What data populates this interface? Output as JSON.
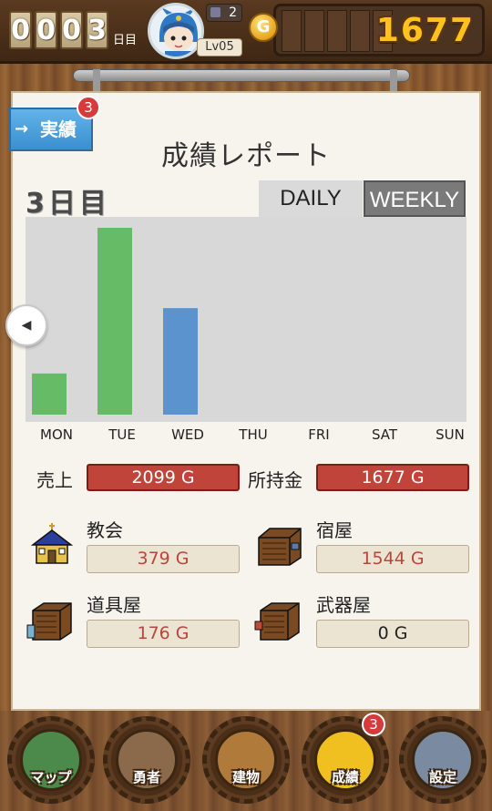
{
  "header": {
    "day_digits": [
      "0",
      "0",
      "0",
      "3"
    ],
    "day_unit": "日目",
    "notification_count": "2",
    "level": "Lv05",
    "coin_symbol": "G",
    "gold": "1677"
  },
  "panel": {
    "achievement_tab": "実績",
    "achievement_badge": "3",
    "title": "成績レポート",
    "day_label": "3日目",
    "tabs": {
      "daily": "DAILY",
      "weekly": "WEEKLY"
    }
  },
  "chart_data": {
    "type": "bar",
    "categories": [
      "MON",
      "TUE",
      "WED",
      "THU",
      "FRI",
      "SAT",
      "SUN"
    ],
    "values": [
      0.22,
      1.0,
      0.57,
      0,
      0,
      0,
      0
    ],
    "bar_colors": [
      "#66bb66",
      "#66bb66",
      "#5b93cf",
      null,
      null,
      null,
      null
    ],
    "title": "",
    "xlabel": "",
    "ylabel": ""
  },
  "stats": {
    "sales_label": "売上",
    "sales_value": "2099  G",
    "money_label": "所持金",
    "money_value": "1677  G"
  },
  "buildings": [
    {
      "name": "教会",
      "value": "379  G"
    },
    {
      "name": "宿屋",
      "value": "1544  G"
    },
    {
      "name": "道具屋",
      "value": "176  G"
    },
    {
      "name": "武器屋",
      "value": "0  G"
    }
  ],
  "nav": {
    "items": [
      {
        "label": "マップ",
        "color": "#4b8a4a"
      },
      {
        "label": "勇者",
        "color": "#8a6a4a"
      },
      {
        "label": "建物",
        "color": "#b07a3a"
      },
      {
        "label": "成績",
        "color": "#f0c020"
      },
      {
        "label": "設定",
        "color": "#7a8aa0"
      }
    ],
    "report_badge": "3"
  }
}
